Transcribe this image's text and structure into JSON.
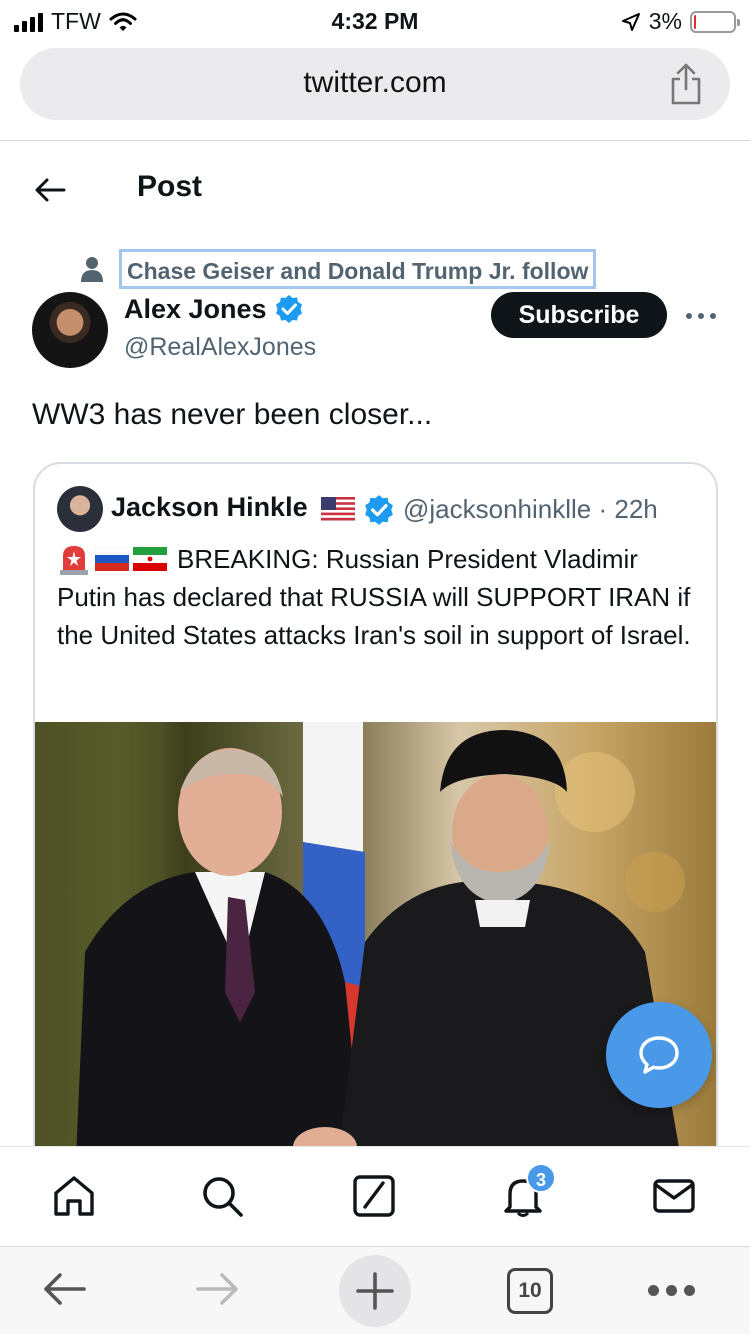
{
  "status_bar": {
    "carrier": "TFW",
    "time": "4:32 PM",
    "battery_percent": "3%",
    "battery_level": 0.03,
    "icons": [
      "signal-icon",
      "wifi-icon",
      "location-arrow-icon",
      "battery-icon"
    ]
  },
  "browser": {
    "url": "twitter.com",
    "share_icon": "share-icon"
  },
  "header": {
    "back_icon": "back-arrow-icon",
    "title": "Post"
  },
  "post": {
    "social_context": "Chase Geiser and Donald Trump Jr. follow",
    "author_name": "Alex Jones",
    "author_handle": "@RealAlexJones",
    "subscribe_label": "Subscribe",
    "text": "WW3 has never been closer...",
    "verified_color": "#1d9bf0"
  },
  "quote": {
    "author_name": "Jackson Hinkle",
    "handle_time": "@jacksonhinklle · 22h",
    "emojis": [
      "siren-emoji",
      "russia-flag-emoji",
      "iran-flag-emoji"
    ],
    "text": "BREAKING: Russian President Vladimir Putin has declared that RUSSIA will SUPPORT IRAN if the United States attacks Iran's soil in support of Israel."
  },
  "bottom_nav": {
    "items": [
      "home-icon",
      "search-icon",
      "compose-icon",
      "notifications-icon",
      "messages-icon"
    ],
    "notification_count": "3"
  },
  "safari_toolbar": {
    "tabs_count": "10",
    "items": [
      "back-icon",
      "forward-icon",
      "new-tab-icon",
      "tabs-icon",
      "more-icon"
    ]
  },
  "colors": {
    "accent": "#1d9bf0",
    "fab": "#4a99e9",
    "text_secondary": "#536471"
  }
}
